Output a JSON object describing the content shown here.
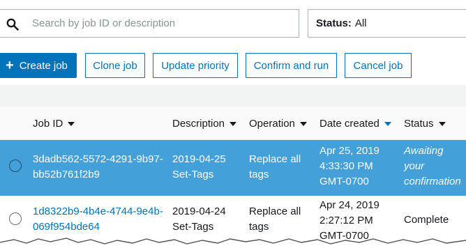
{
  "search": {
    "placeholder": "Search by job ID or description"
  },
  "status_filter": {
    "label": "Status:",
    "value": "All"
  },
  "toolbar": {
    "create_label": "Create job",
    "clone_label": "Clone job",
    "priority_label": "Update priority",
    "confirm_label": "Confirm and run",
    "cancel_label": "Cancel job"
  },
  "table": {
    "columns": [
      "Job ID",
      "Description",
      "Operation",
      "Date created",
      "Status"
    ],
    "rows": [
      {
        "job_id_line1": "3dadb562-5572-4291-9b97-",
        "job_id_line2": "bb52b761f2b9",
        "desc_line1": "2019-04-25",
        "desc_line2": "Set-Tags",
        "op_line1": "Replace all",
        "op_line2": "tags",
        "date_line1": "Apr 25, 2019",
        "date_line2": "4:33:30 PM",
        "date_line3": "GMT-0700",
        "status_line1": "Awaiting",
        "status_line2": "your",
        "status_line3": "confirmation"
      },
      {
        "job_id_line1": "1d8322b9-4b4e-4744-9e4b-",
        "job_id_line2": "069f954bde64",
        "desc_line1": "2019-04-24",
        "desc_line2": "Set-Tags",
        "op_line1": "Replace all",
        "op_line2": "tags",
        "date_line1": "Apr 24, 2019",
        "date_line2": "2:27:12 PM",
        "date_line3": "GMT-0700",
        "status": "Complete"
      }
    ]
  },
  "colors": {
    "accent": "#0073bb",
    "selected_row": "#44a0d9"
  }
}
